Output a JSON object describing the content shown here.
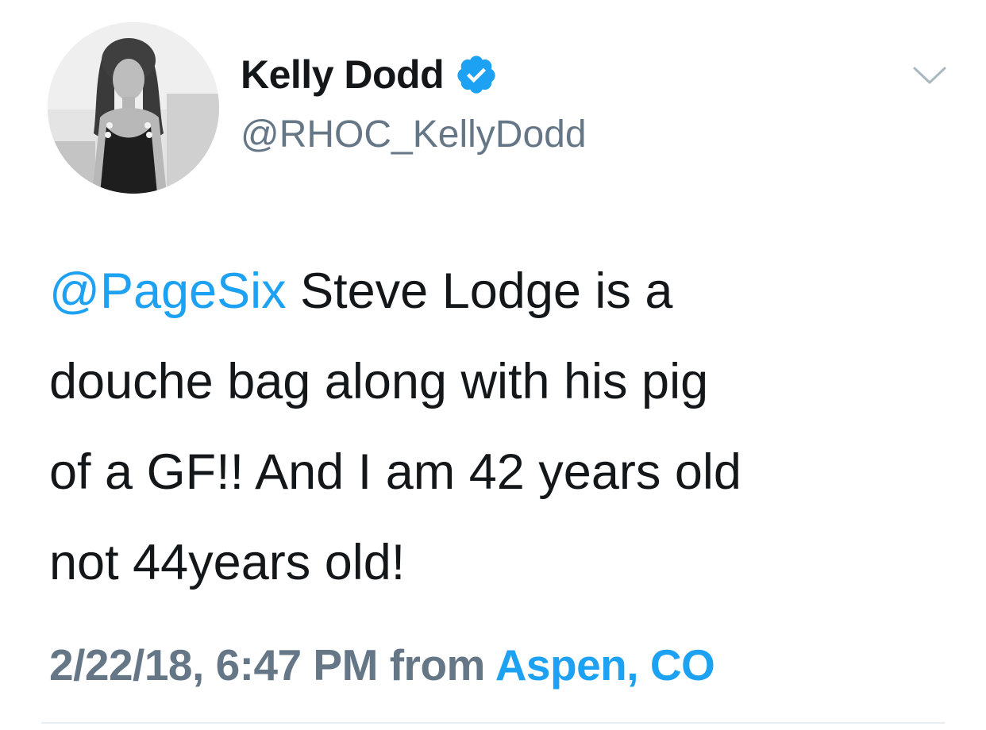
{
  "user": {
    "display_name": "Kelly Dodd",
    "handle": "@RHOC_KellyDodd",
    "verified_icon": "verified-badge-icon"
  },
  "tweet": {
    "mention": "@PageSix",
    "line1_rest": " Steve Lodge is a",
    "line2": "douche bag along with his pig",
    "line3": "of a GF!! And I am 42 years old",
    "line4": "not 44years old!"
  },
  "meta": {
    "timestamp": "2/22/18, 6:47 PM",
    "from_label": " from ",
    "location": "Aspen, CO"
  },
  "icons": {
    "menu": "chevron-down-icon"
  },
  "colors": {
    "link": "#1da1f2",
    "verified": "#1da1f2",
    "secondary_text": "#657786",
    "primary_text": "#14171a"
  }
}
